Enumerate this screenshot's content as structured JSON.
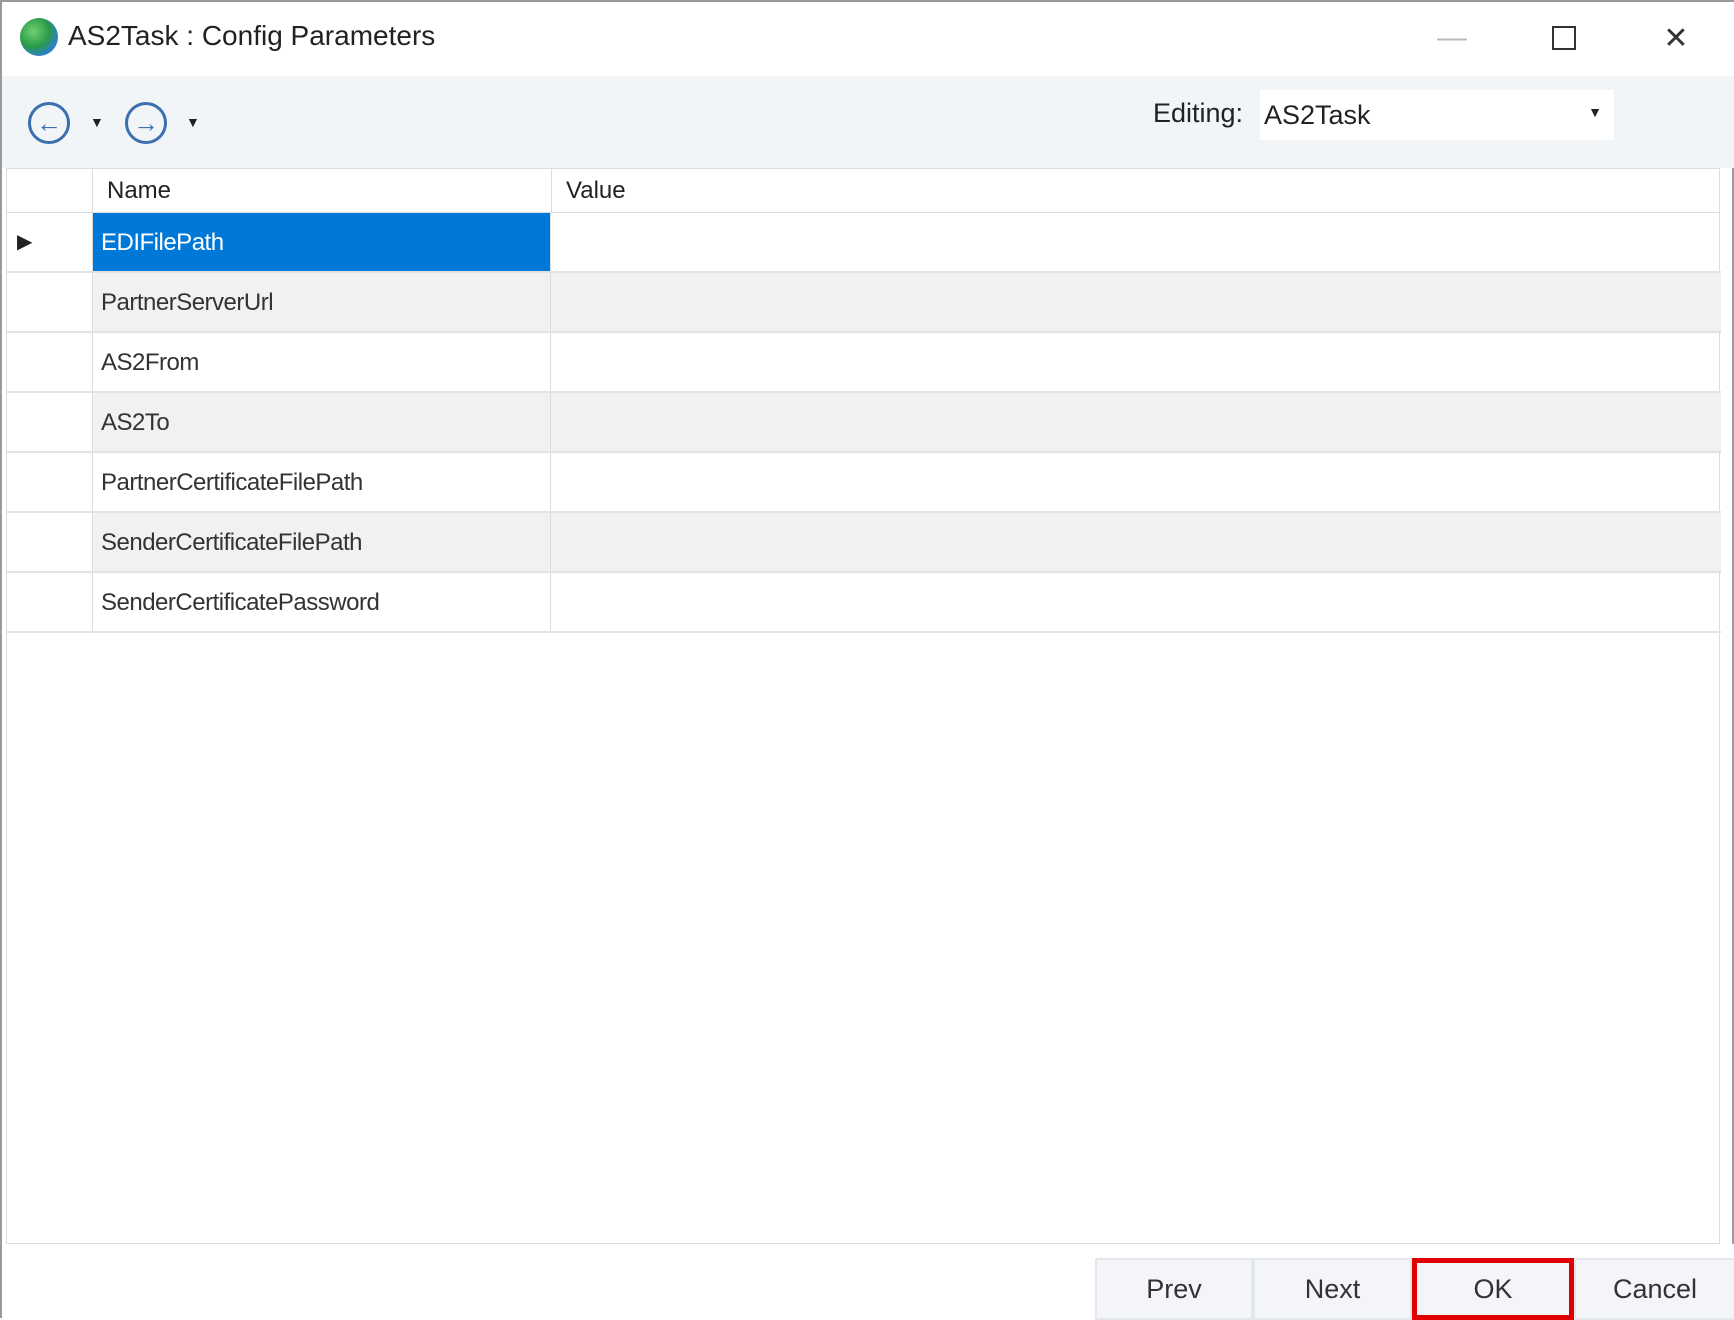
{
  "window": {
    "title": "AS2Task : Config Parameters",
    "minimize_icon": "minimize-icon",
    "maximize_icon": "maximize-icon",
    "close_icon": "close-icon"
  },
  "toolbar": {
    "editing_label": "Editing:",
    "editing_value": "AS2Task"
  },
  "grid": {
    "columns": [
      "Name",
      "Value"
    ],
    "rows": [
      {
        "name": "EDIFilePath",
        "value": "",
        "selected": true
      },
      {
        "name": "PartnerServerUrl",
        "value": ""
      },
      {
        "name": "AS2From",
        "value": ""
      },
      {
        "name": "AS2To",
        "value": ""
      },
      {
        "name": "PartnerCertificateFilePath",
        "value": ""
      },
      {
        "name": "SenderCertificateFilePath",
        "value": ""
      },
      {
        "name": "SenderCertificatePassword",
        "value": ""
      }
    ]
  },
  "buttons": {
    "prev": "Prev",
    "next": "Next",
    "ok": "OK",
    "cancel": "Cancel"
  },
  "colors": {
    "selection": "#0078d7",
    "highlight": "#e00000"
  }
}
